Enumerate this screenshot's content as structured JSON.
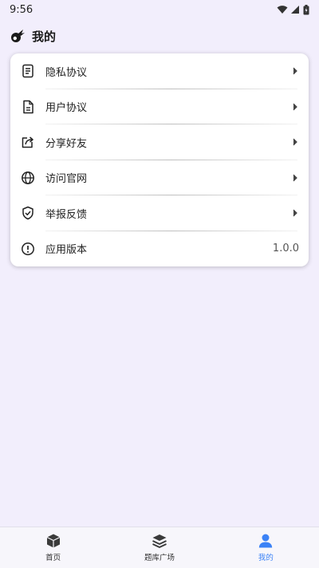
{
  "status_bar": {
    "time": "9:56"
  },
  "header": {
    "title": "我的",
    "icon": "comet-icon"
  },
  "menu": [
    {
      "label": "隐私协议",
      "icon": "document-icon",
      "chevron": true
    },
    {
      "label": "用户协议",
      "icon": "file-icon",
      "chevron": true
    },
    {
      "label": "分享好友",
      "icon": "share-icon",
      "chevron": true
    },
    {
      "label": "访问官网",
      "icon": "globe-icon",
      "chevron": true
    },
    {
      "label": "举报反馈",
      "icon": "shield-check-icon",
      "chevron": true
    },
    {
      "label": "应用版本",
      "icon": "info-icon",
      "value": "1.0.0"
    }
  ],
  "bottom_nav": [
    {
      "label": "首页",
      "icon": "cube-icon",
      "active": false
    },
    {
      "label": "题库广场",
      "icon": "layers-icon",
      "active": false
    },
    {
      "label": "我的",
      "icon": "user-icon",
      "active": true
    }
  ],
  "colors": {
    "accent": "#3b82f6",
    "background": "#f2eefc",
    "card": "#ffffff"
  }
}
